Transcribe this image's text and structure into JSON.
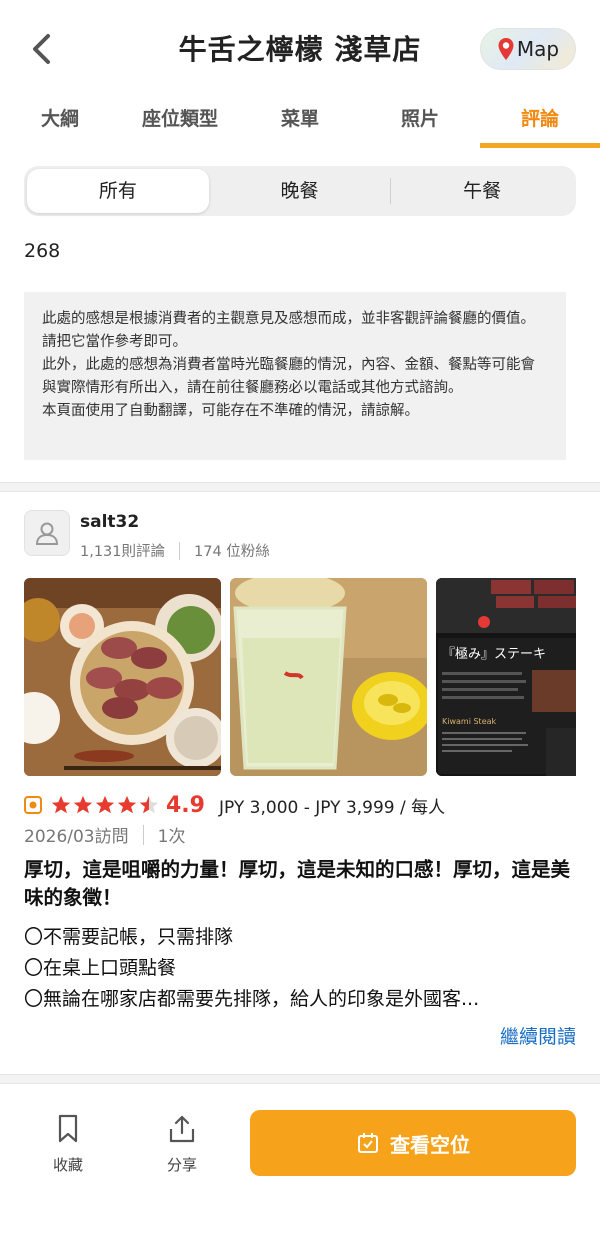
{
  "header": {
    "title": "牛舌之檸檬 淺草店",
    "map_label": "Map"
  },
  "tabs": [
    {
      "label": "大綱"
    },
    {
      "label": "座位類型"
    },
    {
      "label": "菜單"
    },
    {
      "label": "照片"
    },
    {
      "label": "評論",
      "active": true
    }
  ],
  "segments": [
    {
      "label": "所有",
      "active": true
    },
    {
      "label": "晚餐"
    },
    {
      "label": "午餐"
    }
  ],
  "review_count": "268",
  "notice": {
    "line1": "此處的感想是根據消費者的主觀意見及感想而成，並非客觀評論餐廳的價值。請把它當作參考即可。",
    "line2": "此外，此處的感想為消費者當時光臨餐廳的情況，內容、金額、餐點等可能會與實際情形有所出入，請在前往餐廳務必以電話或其他方式諮詢。",
    "line3": "本頁面使用了自動翻譯，可能存在不準確的情況，請諒解。"
  },
  "review": {
    "user": {
      "name": "salt32",
      "reviews": "1,131則評論",
      "followers": "174 位粉絲"
    },
    "rating": "4.9",
    "rating_value": 4.9,
    "price": "JPY 3,000 - JPY 3,999 / 每人",
    "visit_date": "2026/03訪問",
    "visit_count": "1次",
    "title": "厚切，這是咀嚼的力量！厚切，這是未知的口感！厚切，這是美味的象徵！",
    "lines": [
      "〇不需要記帳，只需排隊",
      "〇在桌上口頭點餐",
      "〇無論在哪家店都需要先排隊，給人的印象是外國客..."
    ],
    "read_more": "繼續閱讀",
    "photo3_heading": "『極み』ステーキ",
    "photo3_subheading": "Kiwami Steak"
  },
  "bottom_bar": {
    "bookmark_label": "收藏",
    "share_label": "分享",
    "cta_label": "查看空位"
  },
  "colors": {
    "accent": "#f5a623",
    "rating": "#e63b2e",
    "link": "#1a6fc4",
    "cta": "#f7a21b"
  }
}
